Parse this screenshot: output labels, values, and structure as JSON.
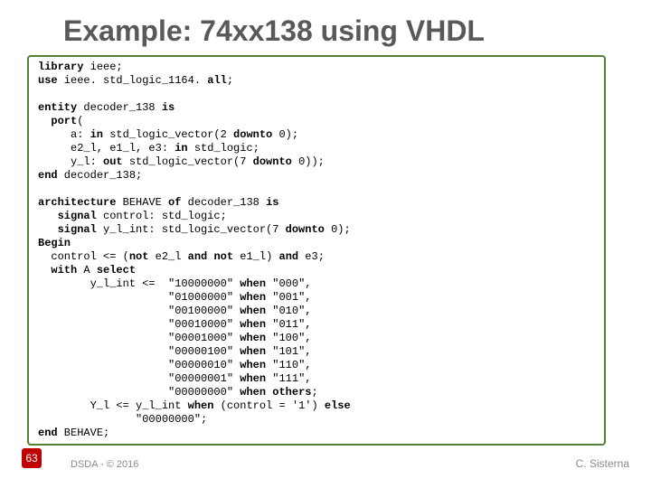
{
  "title": "Example: 74xx138 using VHDL",
  "code": {
    "l1a": "library",
    "l1b": " ieee;",
    "l2a": "use",
    "l2b": " ieee. std_logic_1164. ",
    "l2c": "all",
    "l2d": ";",
    "l3a": "entity",
    "l3b": " decoder_138 ",
    "l3c": "is",
    "l4a": "  port",
    "l4b": "(",
    "l5": "     a: ",
    "l5a": "in",
    "l5b": " std_logic_vector(2 ",
    "l5c": "downto",
    "l5d": " 0);",
    "l6": "     e2_l, e1_l, e3: ",
    "l6a": "in",
    "l6b": " std_logic;",
    "l7": "     y_l: ",
    "l7a": "out",
    "l7b": " std_logic_vector(7 ",
    "l7c": "downto",
    "l7d": " 0));",
    "l8a": "end",
    "l8b": " decoder_138;",
    "l9a": "architecture",
    "l9b": " BEHAVE ",
    "l9c": "of",
    "l9d": " decoder_138 ",
    "l9e": "is",
    "l10a": "   signal",
    "l10b": " control: std_logic;",
    "l11a": "   signal",
    "l11b": " y_l_int: std_logic_vector(7 ",
    "l11c": "downto",
    "l11d": " 0);",
    "l12": "Begin",
    "l13a": "  control <= (",
    "l13b": "not",
    "l13c": " e2_l ",
    "l13d": "and not",
    "l13e": " e1_l) ",
    "l13f": "and",
    "l13g": " e3;",
    "l14a": "  with",
    "l14b": " A ",
    "l14c": "select",
    "l15a": "        y_l_int <=  \"10000000\" ",
    "l15b": "when",
    "l15c": " \"000\",",
    "l16a": "                    \"01000000\" ",
    "l16b": "when",
    "l16c": " \"001\",",
    "l17a": "                    \"00100000\" ",
    "l17b": "when",
    "l17c": " \"010\",",
    "l18a": "                    \"00010000\" ",
    "l18b": "when",
    "l18c": " \"011\",",
    "l19a": "                    \"00001000\" ",
    "l19b": "when",
    "l19c": " \"100\",",
    "l20a": "                    \"00000100\" ",
    "l20b": "when",
    "l20c": " \"101\",",
    "l21a": "                    \"00000010\" ",
    "l21b": "when",
    "l21c": " \"110\",",
    "l22a": "                    \"00000001\" ",
    "l22b": "when",
    "l22c": " \"111\",",
    "l23a": "                    \"00000000\" ",
    "l23b": "when",
    "l23c": " ",
    "l23d": "others",
    "l23e": ";",
    "l24a": "        Y_l <= y_l_int ",
    "l24b": "when",
    "l24c": " (control = '1') ",
    "l24d": "else",
    "l25": "               \"00000000\";",
    "l26a": "end",
    "l26b": " BEHAVE;"
  },
  "footer_left": "DSDA - © 2016",
  "footer_right": "C. Sisterna",
  "slide_number": "63"
}
